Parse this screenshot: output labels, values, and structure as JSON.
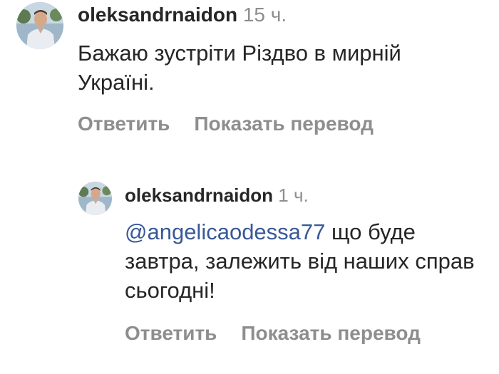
{
  "comments": [
    {
      "username": "oleksandrnaidon",
      "time": "15 ч.",
      "text": "Бажаю зустріти Різдво в мирній Україні.",
      "reply_label": "Ответить",
      "translate_label": "Показать перевод"
    },
    {
      "username": "oleksandrnaidon",
      "time": "1 ч.",
      "mention": "@angelicaodessa77",
      "text": " що буде завтра, залежить від наших справ сьогодні!",
      "reply_label": "Ответить",
      "translate_label": "Показать перевод"
    }
  ],
  "colors": {
    "text": "#262626",
    "secondary": "#8e8e8e",
    "mention": "#385898",
    "background": "#ffffff"
  },
  "icons": {
    "avatar": "user-avatar-photo"
  }
}
